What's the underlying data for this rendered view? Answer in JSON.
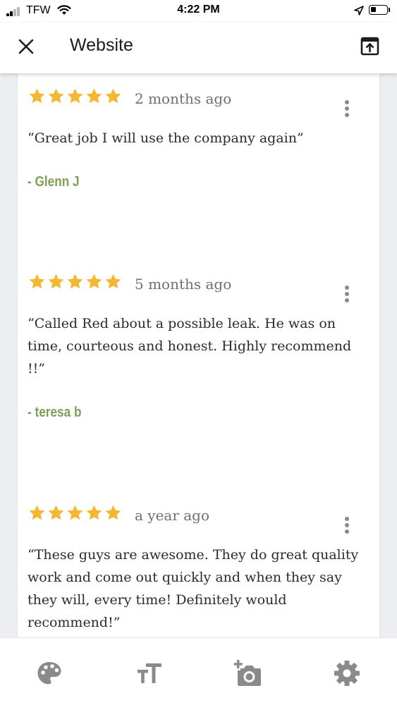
{
  "status_bar": {
    "carrier": "TFW",
    "time": "4:22 PM"
  },
  "header": {
    "title": "Website",
    "close_icon": "close-icon",
    "open_icon": "open-in-browser-icon"
  },
  "reviews": [
    {
      "rating": 5,
      "date": "2 months ago",
      "text": "“Great job I will use the company again”",
      "author": "- Glenn J"
    },
    {
      "rating": 5,
      "date": "5 months ago",
      "text": "“Called Red about a possible leak. He was on time, courteous and honest. Highly recommend !!”",
      "author": "- teresa b"
    },
    {
      "rating": 5,
      "date": "a year ago",
      "text": "“These guys are awesome. They do great quality work and come out quickly and when they say they will, every time! Definitely would recommend!”",
      "author": ""
    }
  ],
  "toolbar": {
    "items": [
      {
        "icon": "palette-icon"
      },
      {
        "icon": "text-size-icon"
      },
      {
        "icon": "add-photo-icon"
      },
      {
        "icon": "gear-icon"
      }
    ]
  },
  "colors": {
    "star": "#f4b731",
    "author": "#7ea05a",
    "background": "#eceef1",
    "icon_gray": "#8a8a8a"
  }
}
